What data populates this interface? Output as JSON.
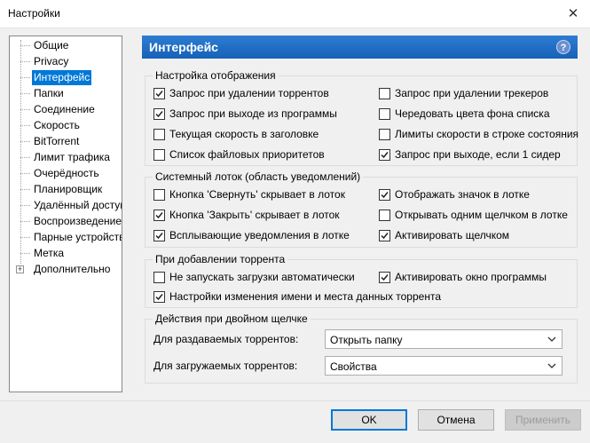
{
  "window": {
    "title": "Настройки"
  },
  "tree": {
    "items": [
      {
        "label": "Общие"
      },
      {
        "label": "Privacy"
      },
      {
        "label": "Интерфейс"
      },
      {
        "label": "Папки"
      },
      {
        "label": "Соединение"
      },
      {
        "label": "Скорость"
      },
      {
        "label": "BitTorrent"
      },
      {
        "label": "Лимит трафика"
      },
      {
        "label": "Очерёдность"
      },
      {
        "label": "Планировщик"
      },
      {
        "label": "Удалённый доступ"
      },
      {
        "label": "Воспроизведение"
      },
      {
        "label": "Парные устройства"
      },
      {
        "label": "Метка"
      },
      {
        "label": "Дополнительно"
      }
    ],
    "selected": "Интерфейс",
    "expander_symbol": "+"
  },
  "panel": {
    "title": "Интерфейс",
    "help_glyph": "?"
  },
  "display": {
    "title": "Настройка отображения",
    "options": [
      {
        "label": "Запрос при удалении торрентов",
        "checked": true
      },
      {
        "label": "Запрос при удалении трекеров",
        "checked": false
      },
      {
        "label": "Запрос при выходе из программы",
        "checked": true
      },
      {
        "label": "Чередовать цвета фона списка",
        "checked": false
      },
      {
        "label": "Текущая скорость в заголовке",
        "checked": false
      },
      {
        "label": "Лимиты скорости в строке состояния",
        "checked": false
      },
      {
        "label": "Список файловых приоритетов",
        "checked": false
      },
      {
        "label": "Запрос при выходе, если 1 сидер",
        "checked": true
      }
    ]
  },
  "tray": {
    "title": "Системный лоток (область уведомлений)",
    "options": [
      {
        "label": "Кнопка 'Свернуть' скрывает в лоток",
        "checked": false
      },
      {
        "label": "Отображать значок в лотке",
        "checked": true
      },
      {
        "label": "Кнопка 'Закрыть' скрывает в лоток",
        "checked": true
      },
      {
        "label": "Открывать одним щелчком в лотке",
        "checked": false
      },
      {
        "label": "Всплывающие уведомления в лотке",
        "checked": true
      },
      {
        "label": "Активировать щелчком",
        "checked": true
      }
    ]
  },
  "adding": {
    "title": "При добавлении торрента",
    "options": [
      {
        "label": "Не запускать загрузки автоматически",
        "checked": false
      },
      {
        "label": "Активировать окно программы",
        "checked": true
      },
      {
        "label": "Настройки изменения имени и места данных торрента",
        "checked": true
      }
    ]
  },
  "dblclick": {
    "title": "Действия при двойном щелчке",
    "seeding_label": "Для раздаваемых торрентов:",
    "seeding_value": "Открыть папку",
    "downloading_label": "Для загружаемых торрентов:",
    "downloading_value": "Свойства"
  },
  "buttons": {
    "ok": "OK",
    "cancel": "Отмена",
    "apply": "Применить"
  },
  "colors": {
    "accent": "#0078d7",
    "header": "#1561b8"
  },
  "icons": {
    "close": "close-icon",
    "help": "help-icon",
    "checkmark": "checkmark-icon",
    "dropdown": "chevron-down-icon"
  }
}
